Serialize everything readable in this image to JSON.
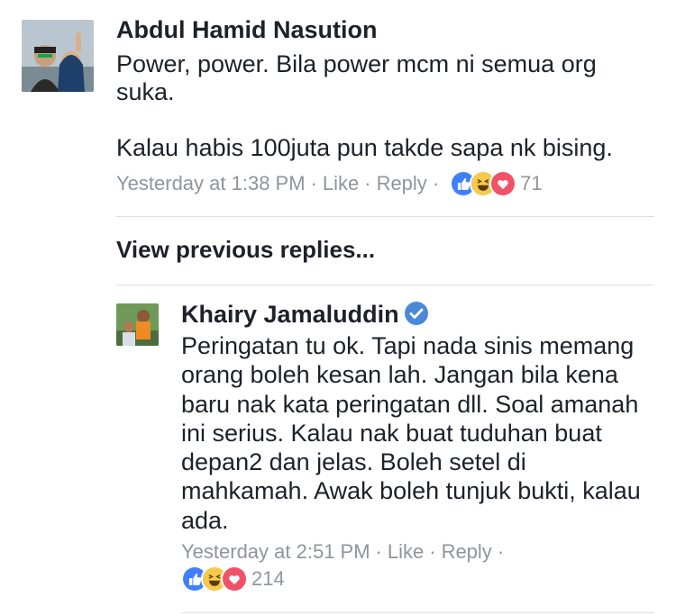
{
  "comment1": {
    "author": "Abdul Hamid Nasution",
    "text_line1": "Power, power. Bila power mcm ni semua org suka.",
    "text_line2": "Kalau habis 100juta pun takde sapa nk bising.",
    "timestamp": "Yesterday at 1:38 PM",
    "like_label": "Like",
    "reply_label": "Reply",
    "reaction_count": "71",
    "reactions": [
      "like-icon",
      "haha-icon",
      "love-icon"
    ]
  },
  "view_previous": "View previous replies...",
  "reply1": {
    "author": "Khairy Jamaluddin",
    "verified": true,
    "text": "Peringatan tu ok. Tapi nada sinis memang orang boleh kesan lah. Jangan bila kena baru nak kata peringatan dll. Soal amanah ini serius. Kalau nak buat tuduhan buat depan2 dan jelas. Boleh setel di mahkamah. Awak boleh tunjuk bukti, kalau ada.",
    "timestamp": "Yesterday at 2:51 PM",
    "like_label": "Like",
    "reply_label": "Reply",
    "reaction_count": "214",
    "reactions": [
      "like-icon",
      "haha-icon",
      "love-icon"
    ]
  },
  "colors": {
    "text": "#1d2129",
    "meta": "#90949c",
    "like_blue": "#4080ff",
    "haha_yellow": "#f7c948",
    "love_red": "#f25268",
    "verified_blue": "#4b88d8",
    "divider": "#dddfe2"
  }
}
